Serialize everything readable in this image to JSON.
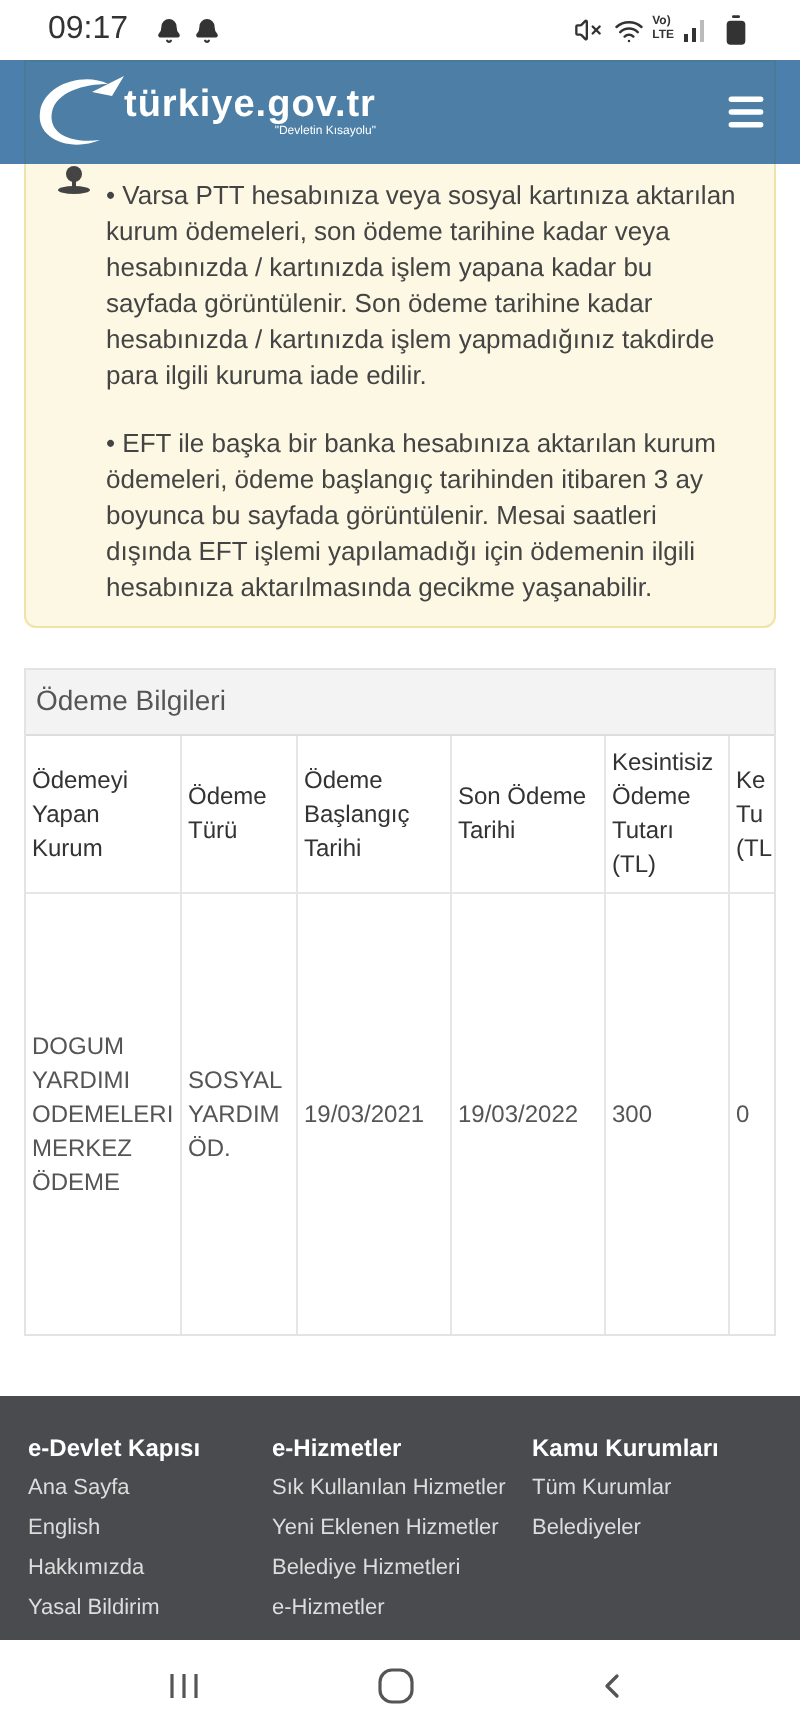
{
  "status_bar": {
    "time": "09:17",
    "network": [
      "Vo)",
      "LTE"
    ]
  },
  "header": {
    "logo_text": "türkiye.gov.tr",
    "tagline": "\"Devletin Kısayolu\""
  },
  "notice": {
    "paragraphs": [
      "• Varsa PTT hesabınıza veya sosyal kartınıza aktarılan kurum ödemeleri, son ödeme tarihine kadar veya hesabınızda / kartınızda işlem yapana kadar bu sayfada görüntülenir. Son ödeme tarihine kadar hesabınızda / kartınızda işlem yapmadığınız takdirde para ilgili kuruma iade edilir.",
      "• EFT ile başka bir banka hesabınıza aktarılan kurum ödemeleri, ödeme başlangıç tarihinden itibaren 3 ay boyunca bu sayfada görüntülenir. Mesai saatleri dışında EFT işlemi yapılamadığı için ödemenin ilgili hesabınıza aktarılmasında gecikme yaşanabilir."
    ]
  },
  "table": {
    "title": "Ödeme Bilgileri",
    "columns": [
      "Ödemeyi Yapan Kurum",
      "Ödeme Türü",
      "Ödeme Başlangıç Tarihi",
      "Son Ödeme Tarihi",
      "Kesintisiz Ödeme Tutarı (TL)",
      "Ke Tu (TL"
    ],
    "rows": [
      [
        "DOGUM YARDIMI ODEMELERI MERKEZ ÖDEME",
        "SOSYAL YARDIM ÖD.",
        "19/03/2021",
        "19/03/2022",
        "300",
        "0"
      ]
    ]
  },
  "footer": {
    "columns": [
      {
        "title": "e-Devlet Kapısı",
        "links": [
          "Ana Sayfa",
          "English",
          "Hakkımızda",
          "Yasal Bildirim"
        ]
      },
      {
        "title": "e-Hizmetler",
        "links": [
          "Sık Kullanılan Hizmetler",
          "Yeni Eklenen Hizmetler",
          "Belediye Hizmetleri",
          "e-Hizmetler"
        ]
      },
      {
        "title": "Kamu Kurumları",
        "links": [
          "Tüm Kurumlar",
          "Belediyeler"
        ]
      }
    ]
  }
}
